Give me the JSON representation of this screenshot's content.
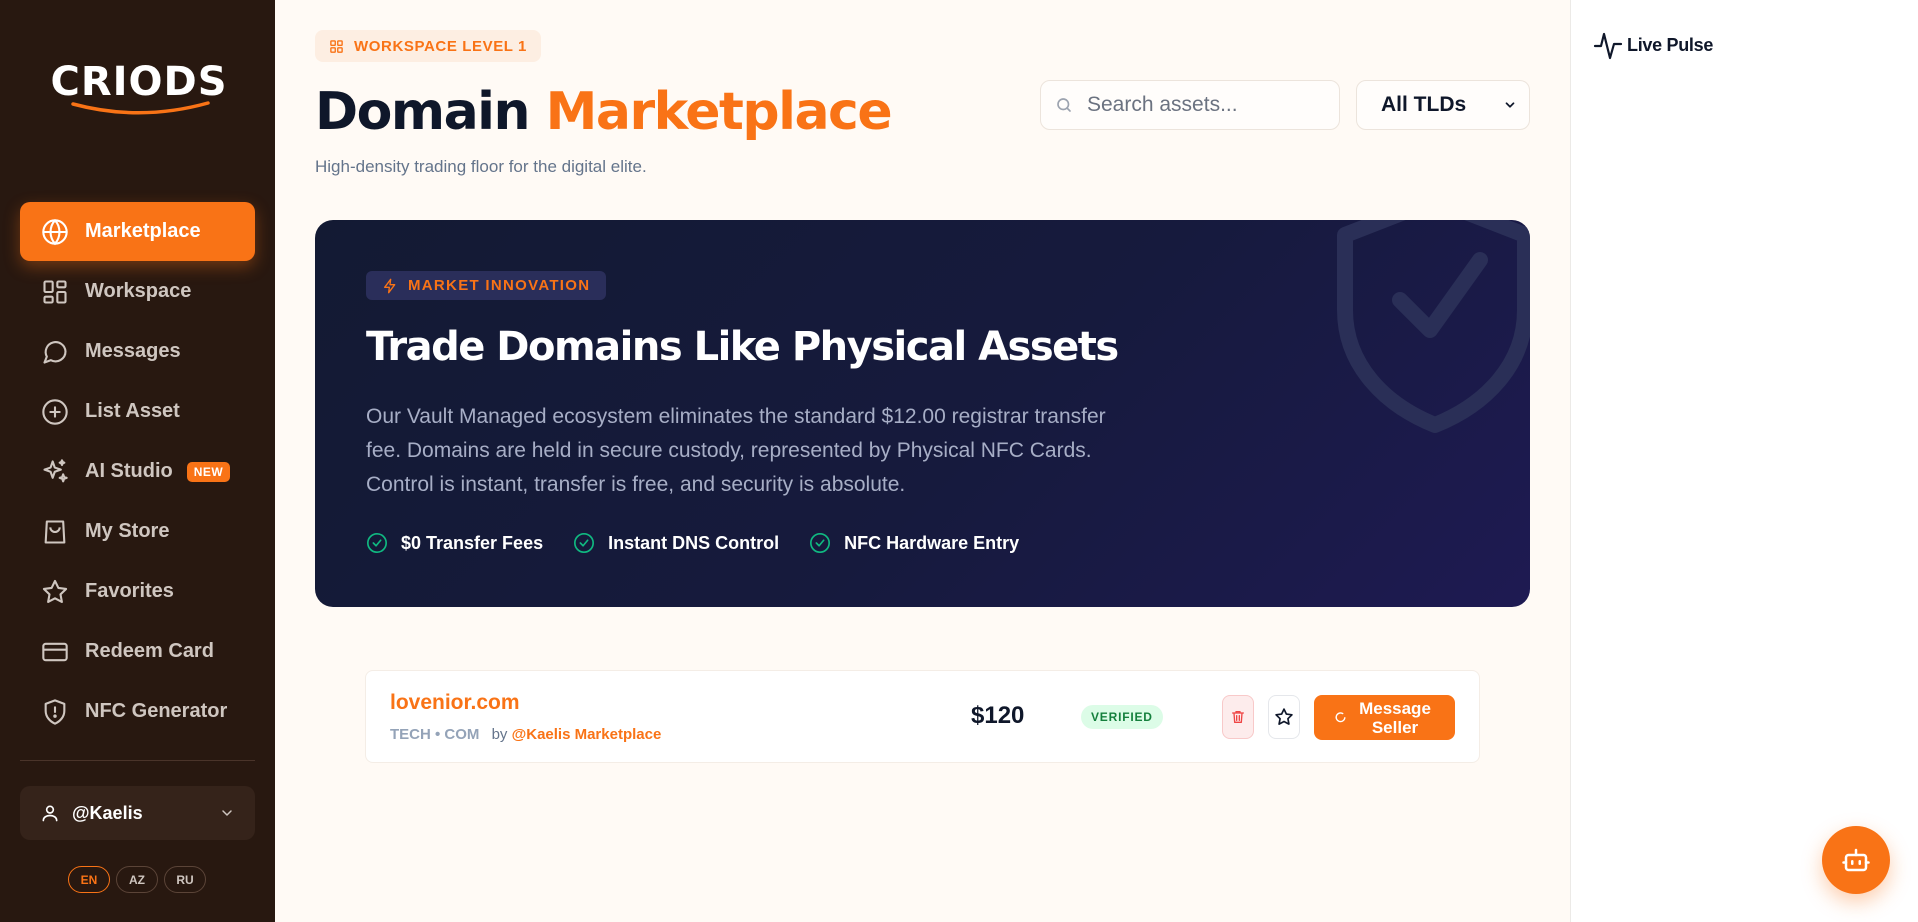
{
  "brand": {
    "logo_text": "CRIODS"
  },
  "sidebar": {
    "items": [
      {
        "label": "Marketplace",
        "icon": "globe-icon",
        "active": true
      },
      {
        "label": "Workspace",
        "icon": "grid-icon"
      },
      {
        "label": "Messages",
        "icon": "message-icon"
      },
      {
        "label": "List Asset",
        "icon": "plus-circle-icon"
      },
      {
        "label": "AI Studio",
        "icon": "sparkles-icon",
        "badge": "NEW"
      },
      {
        "label": "My Store",
        "icon": "shopping-bag-icon"
      },
      {
        "label": "Favorites",
        "icon": "star-icon"
      },
      {
        "label": "Redeem Card",
        "icon": "credit-card-icon"
      },
      {
        "label": "NFC Generator",
        "icon": "shield-icon"
      }
    ],
    "user": {
      "handle": "@Kaelis"
    },
    "languages": [
      {
        "code": "EN",
        "active": true
      },
      {
        "code": "AZ"
      },
      {
        "code": "RU"
      }
    ]
  },
  "header": {
    "workspace_pill": "WORKSPACE LEVEL 1",
    "title_part1": "Domain",
    "title_part2": "Marketplace",
    "subtitle": "High-density trading floor for the digital elite.",
    "search": {
      "placeholder": "Search assets...",
      "value": ""
    },
    "tld_filter": {
      "selected": "All TLDs"
    }
  },
  "hero": {
    "tag": "MARKET INNOVATION",
    "title": "Trade Domains Like Physical Assets",
    "description": "Our Vault Managed ecosystem eliminates the standard $12.00 registrar transfer fee. Domains are held in secure custody, represented by Physical NFC Cards. Control is instant, transfer is free, and security is absolute.",
    "features": [
      "$0 Transfer Fees",
      "Instant DNS Control",
      "NFC Hardware Entry"
    ]
  },
  "listings": [
    {
      "domain": "lovenior.com",
      "meta": "TECH • COM",
      "by_label": "by",
      "seller": "@Kaelis Marketplace",
      "price": "$120",
      "status": "VERIFIED",
      "message_label": "Message Seller"
    }
  ],
  "right_panel": {
    "title": "Live Pulse"
  },
  "colors": {
    "accent": "#f97316",
    "sidebar_bg": "#281810",
    "hero_bg": "#161a3d",
    "verified_bg": "#dcfce7",
    "verified_text": "#15803d"
  }
}
